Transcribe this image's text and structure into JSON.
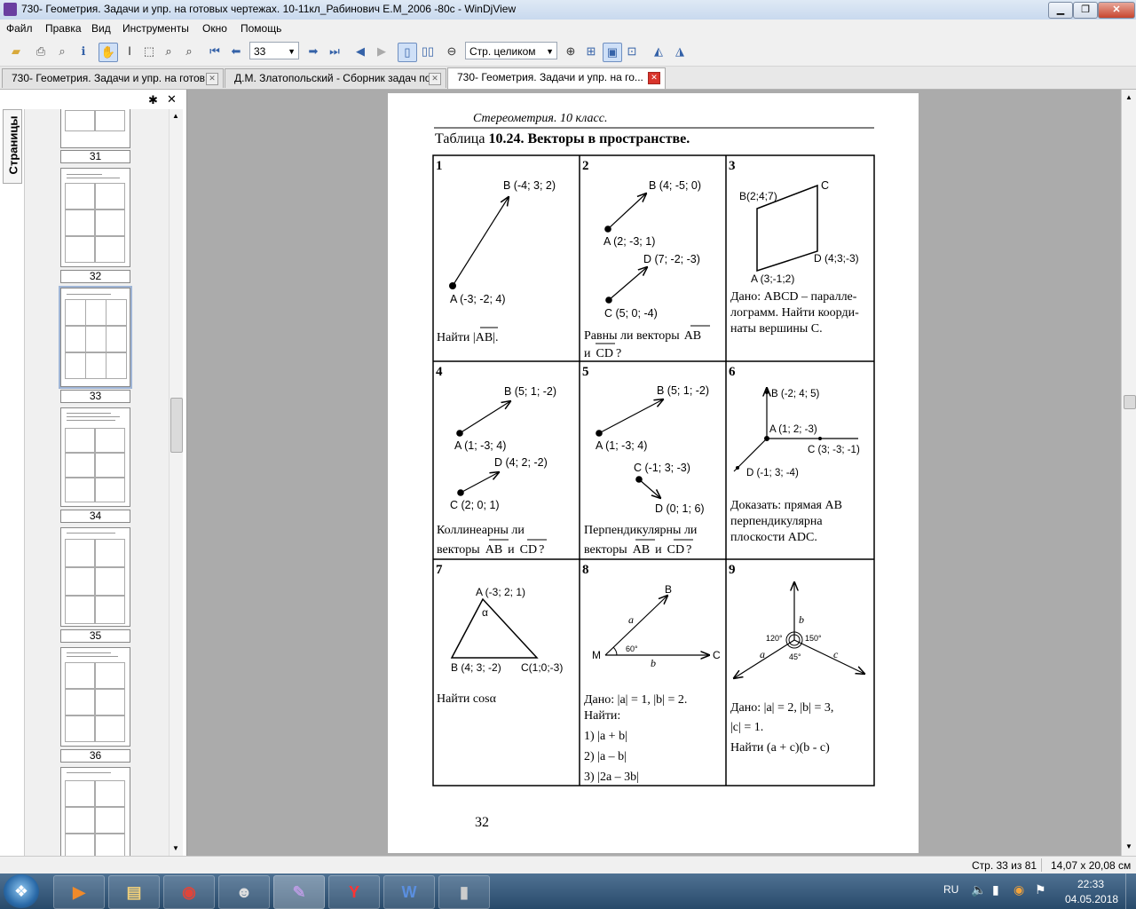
{
  "window": {
    "title": "730- Геометрия. Задачи и упр. на готовых чертежах. 10-11кл_Рабинович Е.М_2006 -80с - WinDjView"
  },
  "menu": [
    "Файл",
    "Правка",
    "Вид",
    "Инструменты",
    "Окно",
    "Помощь"
  ],
  "toolbar": {
    "page_number": "33",
    "zoom": "Стр. целиком"
  },
  "tabs": [
    {
      "label": "730- Геометрия. Задачи и упр. на готов...",
      "active": false
    },
    {
      "label": "Д.М. Златопольский - Сборник задач по...",
      "active": false
    },
    {
      "label": "730- Геометрия. Задачи и упр. на го...",
      "active": true
    }
  ],
  "sidebar": {
    "tab_label": "Страницы",
    "thumbnails": [
      "31",
      "32",
      "33",
      "34",
      "35",
      "36"
    ],
    "selected": "33"
  },
  "page": {
    "header": "Стереометрия. 10 класс.",
    "table_title_prefix": "Таблица ",
    "table_title_bold": "10.24. Векторы в пространстве.",
    "page_number": "32",
    "cells": {
      "c1": {
        "num": "1",
        "B": "B (-4; 3; 2)",
        "A": "A (-3; -2; 4)",
        "q1": "Найти |",
        "q_vec": "AB",
        "q2": "|."
      },
      "c2": {
        "num": "2",
        "B": "B (4; -5; 0)",
        "A": "A (2; -3; 1)",
        "D": "D (7; -2; -3)",
        "C": "C (5; 0; -4)",
        "q1": "Равны ли векторы",
        "v1": "AB",
        "q2": "и",
        "v2": "CD",
        "q3": "?"
      },
      "c3": {
        "num": "3",
        "B": "B(2;4;7)",
        "C": "C",
        "D": "D (4;3;-3)",
        "A": "A (3;-1;2)",
        "l1": "Дано: ABCD – паралле-",
        "l2": "лограмм. Найти коорди-",
        "l3": "наты вершины C."
      },
      "c4": {
        "num": "4",
        "B": "B (5; 1; -2)",
        "A": "A (1; -3; 4)",
        "D": "D (4; 2; -2)",
        "C": "C (2; 0; 1)",
        "l1": "Коллинеарны ли",
        "q1": "векторы",
        "v1": "AB",
        "q2": "и",
        "v2": "CD",
        "q3": "?"
      },
      "c5": {
        "num": "5",
        "B": "B (5; 1; -2)",
        "A": "A (1; -3; 4)",
        "C": "C (-1; 3; -3)",
        "D": "D (0; 1; 6)",
        "l1": "Перпендикулярны ли",
        "q1": "векторы",
        "v1": "AB",
        "q2": "и",
        "v2": "CD",
        "q3": "?"
      },
      "c6": {
        "num": "6",
        "B": "B (-2; 4; 5)",
        "A": "A (1; 2; -3)",
        "C": "C (3; -3; -1)",
        "D": "D (-1; 3; -4)",
        "l1": "Доказать: прямая AB",
        "l2": "перпендикулярна",
        "l3": "плоскости ADC."
      },
      "c7": {
        "num": "7",
        "A": "A (-3; 2; 1)",
        "alpha": "α",
        "B": "B (4; 3; -2)",
        "C": "C(1;0;-3)",
        "q": "Найти cosα"
      },
      "c8": {
        "num": "8",
        "B": "B",
        "M": "M",
        "C": "C",
        "angle": "60°",
        "a": "a",
        "b": "b",
        "l1": "Дано: |a| = 1, |b| = 2.",
        "l2": "Найти:",
        "l3": "1) |a + b|",
        "l4": "2) |a – b|",
        "l5": "3) |2a – 3b|"
      },
      "c9": {
        "num": "9",
        "b": "b",
        "a": "a",
        "c": "c",
        "ang1": "120°",
        "ang2": "150°",
        "ang3": "45°",
        "l1": "Дано: |a| = 2, |b| = 3,",
        "l2": "|c| = 1.",
        "l3": "Найти (a + c)(b - c)"
      }
    }
  },
  "status": {
    "page_info": "Стр. 33 из 81",
    "page_size": "14,07 x 20,08 см"
  },
  "taskbar": {
    "lang": "RU",
    "time": "22:33",
    "date": "04.05.2018",
    "apps": [
      "media-player",
      "file-explorer",
      "chrome",
      "alien-app",
      "windjview",
      "yandex-browser",
      "word",
      "phone-app"
    ]
  }
}
